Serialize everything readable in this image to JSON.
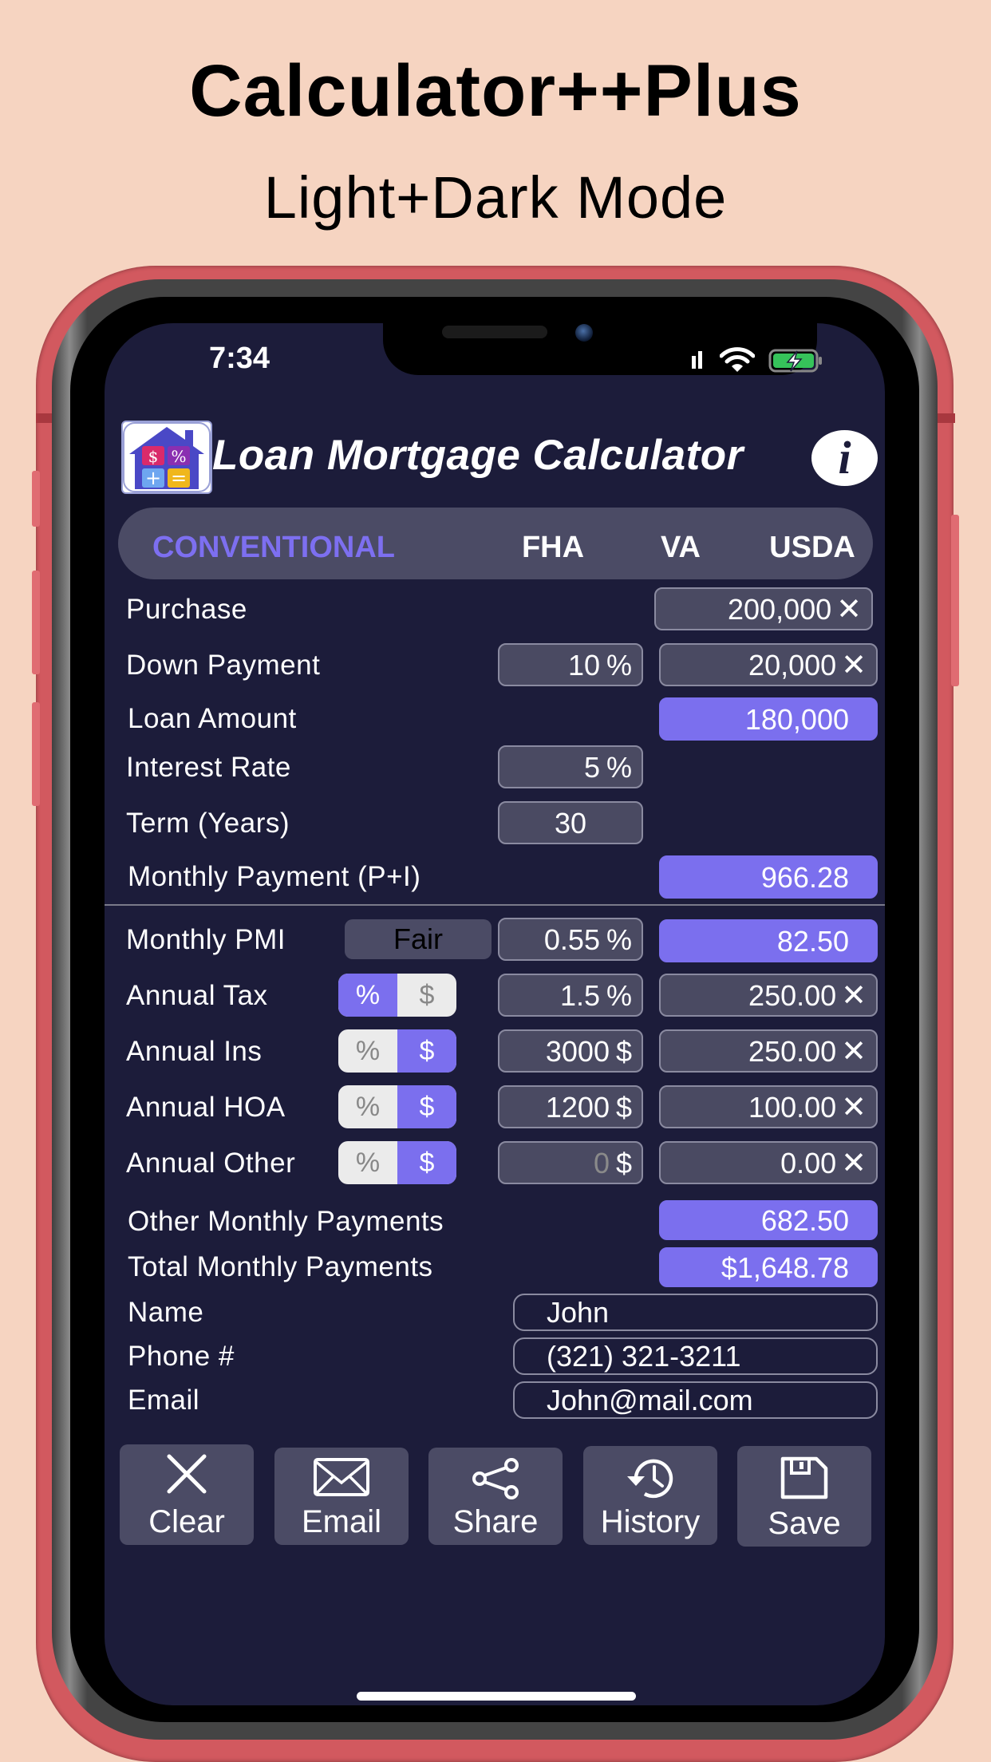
{
  "promo": {
    "title": "Calculator++Plus",
    "subtitle": "Light+Dark Mode"
  },
  "status_bar": {
    "time": "7:34",
    "icons": [
      "cellular-signal-icon",
      "wifi-icon",
      "battery-charging-icon"
    ]
  },
  "header": {
    "title": "Loan Mortgage Calculator",
    "logo": "house-calculator-logo",
    "info_label": "i"
  },
  "tabs": [
    {
      "label": "CONVENTIONAL",
      "active": true
    },
    {
      "label": "FHA",
      "active": false
    },
    {
      "label": "VA",
      "active": false
    },
    {
      "label": "USDA",
      "active": false
    }
  ],
  "loan": {
    "purchase": {
      "label": "Purchase",
      "value": "200,000",
      "clear": "✕"
    },
    "down_payment": {
      "label": "Down Payment",
      "percent": "10",
      "percent_unit": "%",
      "value": "20,000",
      "clear": "✕"
    },
    "loan_amount": {
      "label": "Loan Amount",
      "value": "180,000"
    },
    "interest_rate": {
      "label": "Interest Rate",
      "value": "5",
      "unit": "%"
    },
    "term": {
      "label": "Term (Years)",
      "value": "30"
    },
    "monthly_payment": {
      "label": "Monthly Payment (P+I)",
      "value": "966.28"
    }
  },
  "extras": {
    "pmi": {
      "label": "Monthly PMI",
      "credit": "Fair",
      "rate": "0.55",
      "unit": "%",
      "value": "82.50"
    },
    "tax": {
      "label": "Annual Tax",
      "toggle": [
        "%",
        "$"
      ],
      "selected": "%",
      "input": "1.5",
      "unit": "%",
      "value": "250.00",
      "clear": "✕"
    },
    "ins": {
      "label": "Annual Ins",
      "toggle": [
        "%",
        "$"
      ],
      "selected": "$",
      "input": "3000",
      "unit": "$",
      "value": "250.00",
      "clear": "✕"
    },
    "hoa": {
      "label": "Annual HOA",
      "toggle": [
        "%",
        "$"
      ],
      "selected": "$",
      "input": "1200",
      "unit": "$",
      "value": "100.00",
      "clear": "✕"
    },
    "other": {
      "label": "Annual Other",
      "toggle": [
        "%",
        "$"
      ],
      "selected": "$",
      "input_placeholder": "0",
      "unit": "$",
      "value": "0.00",
      "clear": "✕"
    }
  },
  "totals": {
    "other_monthly": {
      "label": "Other Monthly Payments",
      "value": "682.50"
    },
    "total_monthly": {
      "label": "Total Monthly Payments",
      "value": "$1,648.78"
    }
  },
  "contact": {
    "name": {
      "label": "Name",
      "value": "John"
    },
    "phone": {
      "label": "Phone #",
      "value": "(321) 321-3211"
    },
    "email": {
      "label": "Email",
      "value": "John@mail.com"
    }
  },
  "actions": [
    {
      "label": "Clear",
      "icon": "close-icon"
    },
    {
      "label": "Email",
      "icon": "envelope-icon"
    },
    {
      "label": "Share",
      "icon": "share-icon"
    },
    {
      "label": "History",
      "icon": "history-icon"
    },
    {
      "label": "Save",
      "icon": "save-icon"
    }
  ],
  "colors": {
    "background": "#f6d4c1",
    "phone_case": "#d2595f",
    "screen": "#1c1c3a",
    "accent": "#7b6fee",
    "field": "#4a4a62"
  }
}
